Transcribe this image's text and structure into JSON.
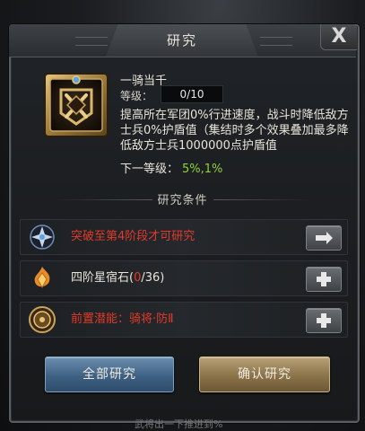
{
  "window": {
    "title": "研究",
    "close_label": "X"
  },
  "skill": {
    "icon": "banner-shield-icon",
    "name": "一骑当千",
    "level_label": "等级：",
    "level_value": "0/10",
    "description": "提高所在军团0%行进速度，战斗时降低敌方士兵0%护盾值（集结时多个效果叠加最多降低敌方士兵1000000点护盾值",
    "next_label": "下一等级：",
    "next_value": "5%,1%"
  },
  "conditions": {
    "title": "研究条件",
    "rows": [
      {
        "icon": "star-emblem-icon",
        "text": "突破至第4阶段才可研究",
        "text_color": "#e33a2a",
        "button_icon": "arrow-right-icon"
      },
      {
        "icon": "fire-crystal-icon",
        "text_prefix": "四阶星宿石(",
        "count_current": "0",
        "count_sep": "/36)",
        "count_color": "#e33a2a",
        "button_icon": "plus-icon"
      },
      {
        "icon": "round-medal-icon",
        "text": "前置潜能：骑将·防Ⅱ",
        "text_color": "#e33a2a",
        "button_icon": "plus-icon"
      }
    ]
  },
  "buttons": {
    "research_all": "全部研究",
    "confirm_research": "确认研究"
  },
  "footer": {
    "text": "武将出一下推进到%"
  },
  "colors": {
    "accent_red": "#e33a2a",
    "accent_green": "#8fd13a",
    "blue_button": "#3f6184",
    "gold_button": "#8a7249"
  }
}
